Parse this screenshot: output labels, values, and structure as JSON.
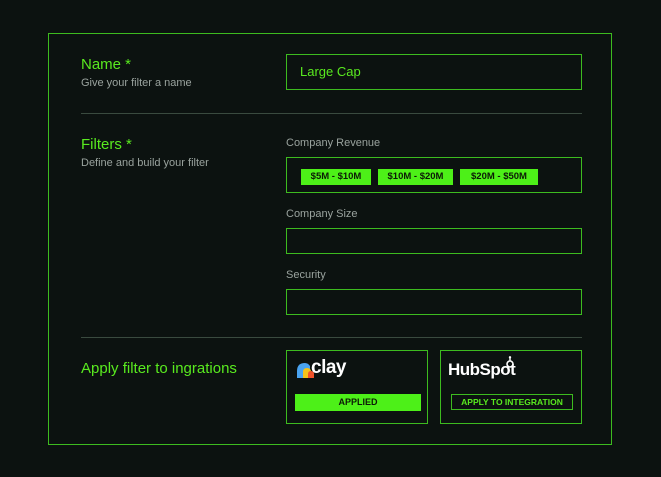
{
  "name_section": {
    "title": "Name *",
    "subtitle": "Give your filter a name",
    "value": "Large Cap"
  },
  "filters_section": {
    "title": "Filters *",
    "subtitle": "Define and build your filter",
    "company_revenue": {
      "label": "Company Revenue",
      "chips": [
        "$5M - $10M",
        "$10M - $20M",
        "$20M - $50M"
      ]
    },
    "company_size": {
      "label": "Company Size",
      "value": ""
    },
    "security": {
      "label": "Security",
      "value": ""
    }
  },
  "integrations_section": {
    "title": "Apply filter to ingrations",
    "clay": {
      "logo_text": "clay",
      "logo_icon": "clay-logo-icon",
      "button": "APPLIED"
    },
    "hubspot": {
      "logo_text": "HubSpot",
      "logo_icon": "hubspot-logo-icon",
      "button": "APPLY TO INTEGRATION"
    }
  },
  "colors": {
    "background": "#0c1210",
    "accent": "#59ea1f",
    "chip": "#4df018",
    "border": "#3dbb1f",
    "muted_text": "#9aa39e"
  }
}
